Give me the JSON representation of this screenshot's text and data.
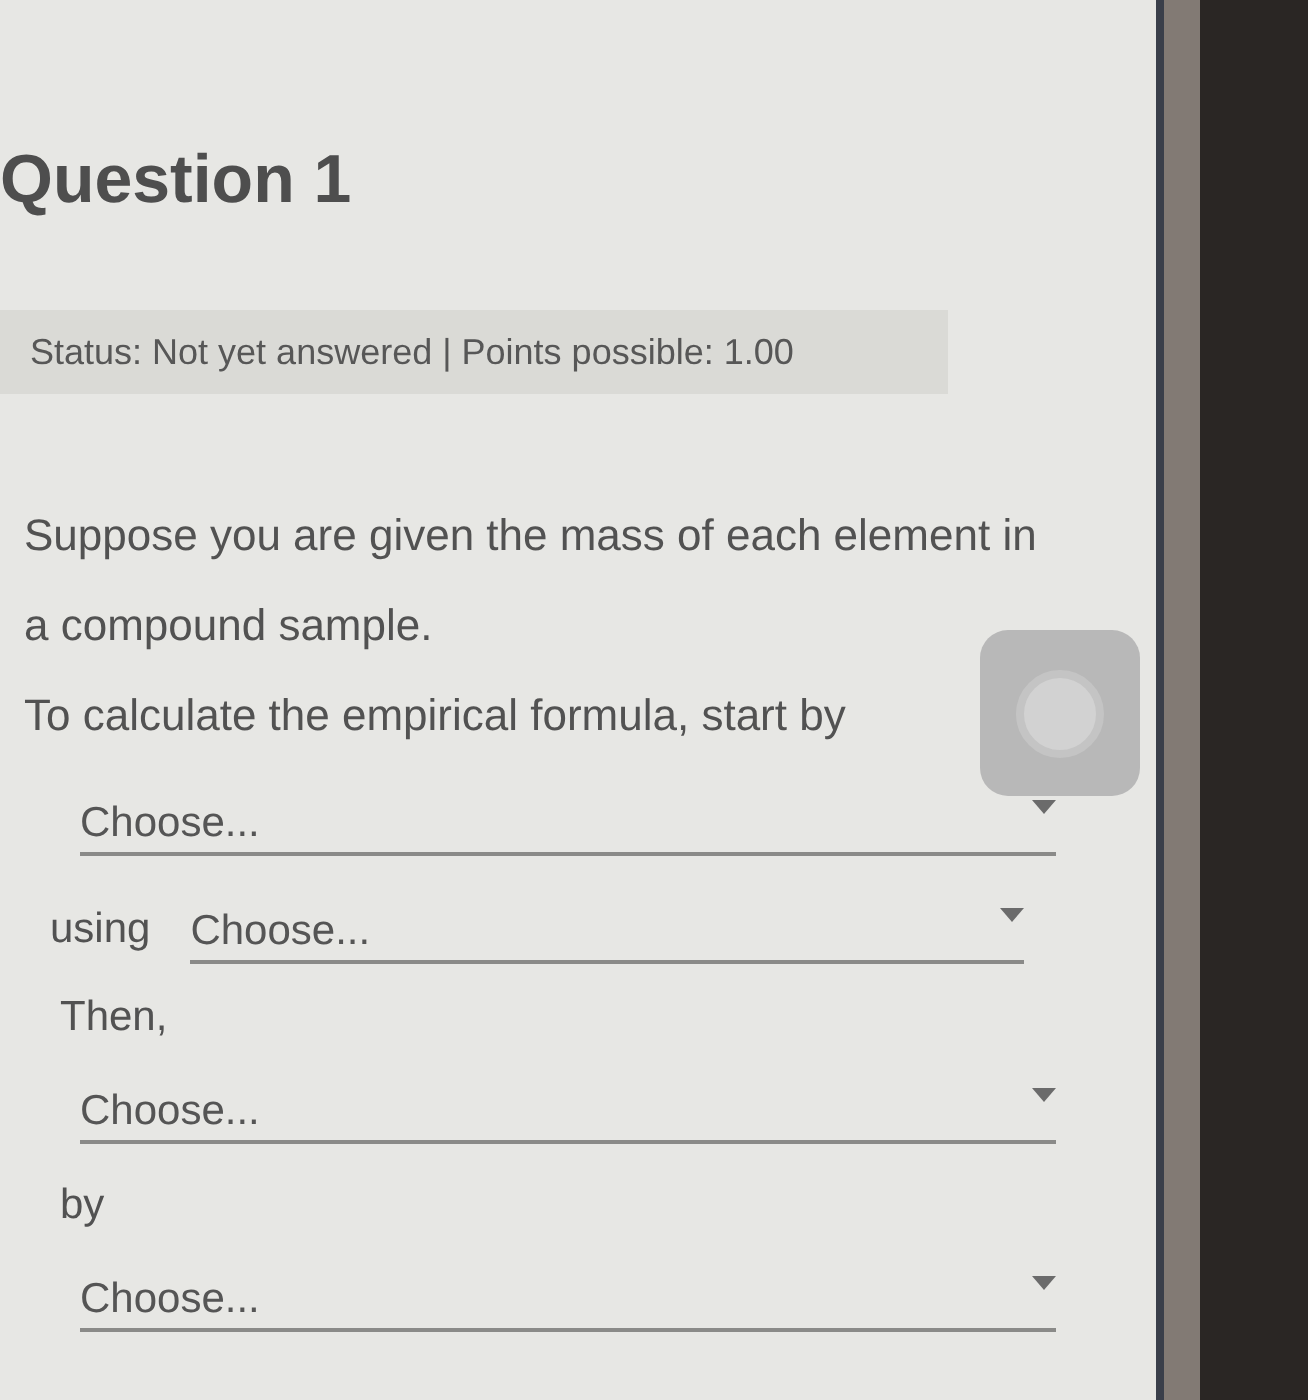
{
  "question": {
    "title": "Question 1",
    "status": "Status: Not yet answered | Points possible: 1.00"
  },
  "body": [
    {
      "kind": "paragraph",
      "text": "Suppose you are given the mass of each element in a compound sample."
    },
    {
      "kind": "paragraph",
      "text": "To calculate the empirical formula, start by"
    },
    {
      "kind": "dropdown",
      "value": "Choose..."
    },
    {
      "kind": "inline_dropdown",
      "label": "using",
      "value": "Choose..."
    },
    {
      "kind": "connector",
      "text": "Then,"
    },
    {
      "kind": "dropdown",
      "value": "Choose..."
    },
    {
      "kind": "connector",
      "text": "by"
    },
    {
      "kind": "dropdown",
      "value": "Choose..."
    }
  ]
}
